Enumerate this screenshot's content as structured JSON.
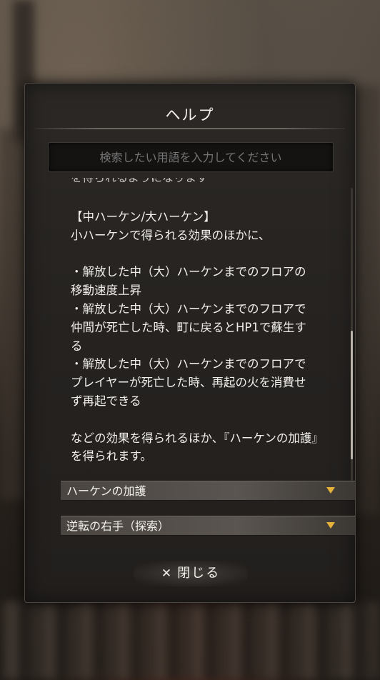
{
  "dialog": {
    "title": "ヘルプ",
    "search_placeholder": "検索したい用語を入力してください",
    "cut_text": "を得られるようになります",
    "body": "【中ハーケン/大ハーケン】\n小ハーケンで得られる効果のほかに、\n\n・解放した中（大）ハーケンまでのフロアの\n移動速度上昇\n・解放した中（大）ハーケンまでのフロアで\n仲間が死亡した時、町に戻るとHP1で蘇生す\nる\n・解放した中（大）ハーケンまでのフロアで\nプレイヤーが死亡した時、再起の火を消費せ\nず再起できる\n\nなどの効果を得られるほか、『ハーケンの加護』\nを得られます。",
    "accordion": [
      {
        "label": "ハーケンの加護"
      },
      {
        "label": "逆転の右手（探索）"
      }
    ],
    "close_label": "閉じる",
    "close_icon": "✕"
  },
  "colors": {
    "accent_chevron": "#e6b23a",
    "text": "#f1efeb"
  }
}
